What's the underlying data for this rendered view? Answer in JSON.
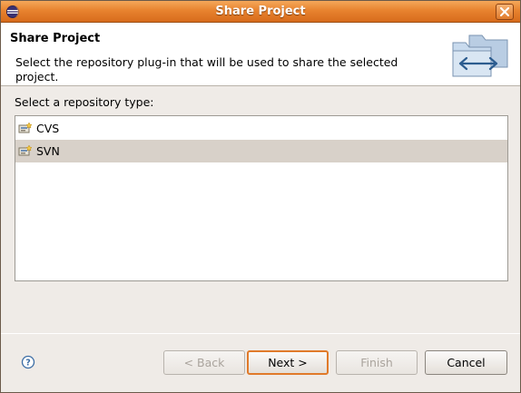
{
  "window": {
    "title": "Share Project"
  },
  "header": {
    "title": "Share Project",
    "description": "Select the repository plug-in that will be used to share the selected project."
  },
  "repository": {
    "label": "Select a repository type:",
    "items": [
      {
        "label": "CVS",
        "icon": "repository-icon",
        "selected": false
      },
      {
        "label": "SVN",
        "icon": "repository-icon",
        "selected": true
      }
    ]
  },
  "buttons": {
    "back": "< Back",
    "next": "Next >",
    "finish": "Finish",
    "cancel": "Cancel"
  },
  "colors": {
    "titlebar": "#e8832f",
    "selection": "#d8d1c9",
    "default_button_border": "#e07a2a"
  }
}
